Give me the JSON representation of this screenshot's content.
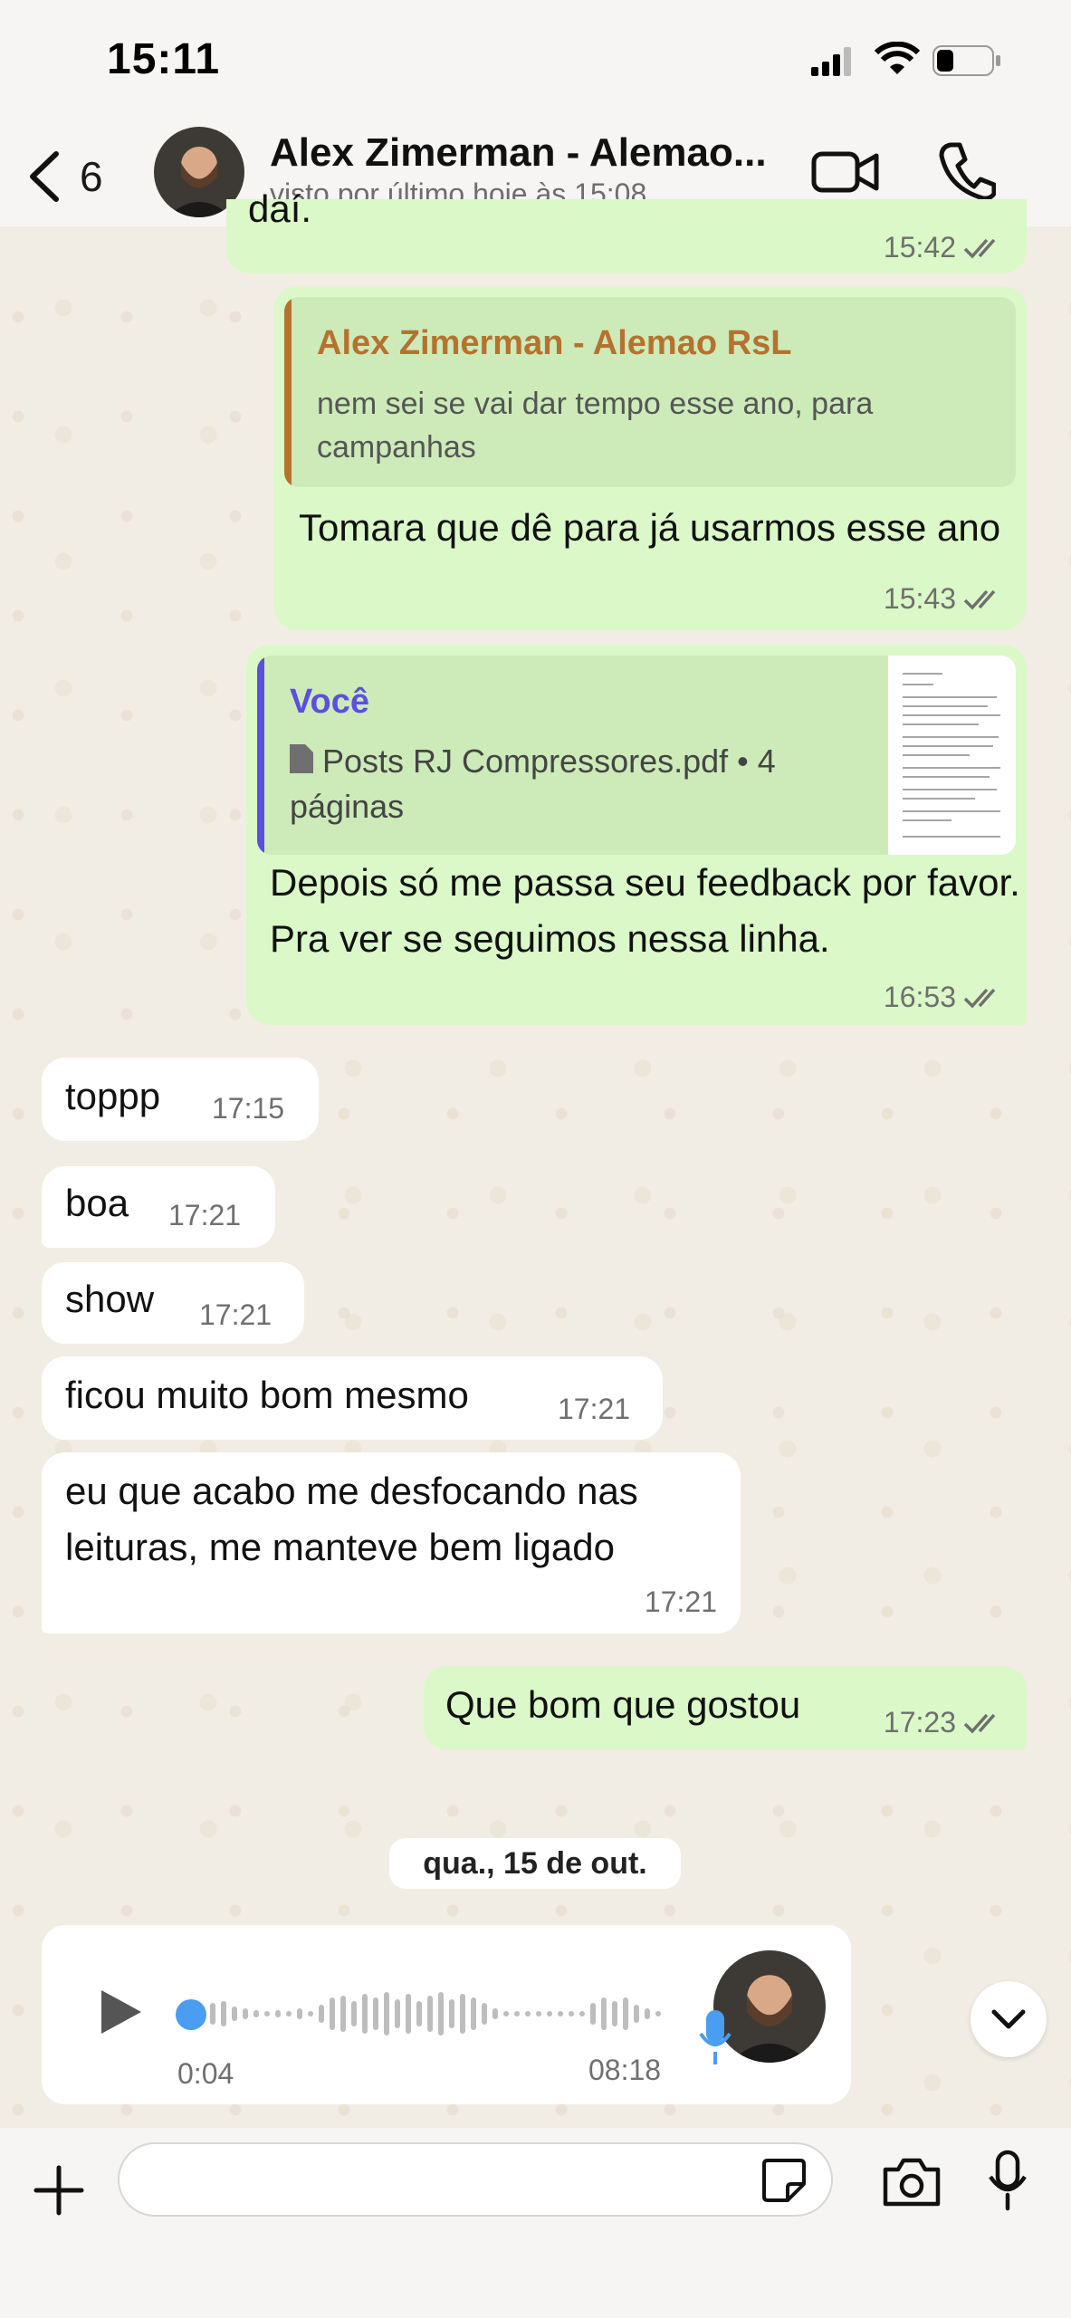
{
  "status_bar": {
    "time": "15:11"
  },
  "header": {
    "back_count": "6",
    "contact_name": "Alex Zimerman - Alemao...",
    "contact_status": "visto por último hoje às 15:08"
  },
  "messages": [
    {
      "text": "daí.",
      "time": "15:42"
    },
    {
      "quote_author": "Alex Zimerman - Alemao RsL",
      "quote_text": "nem sei se vai dar tempo esse ano, para campanhas",
      "text": "Tomara que dê para já usarmos esse ano",
      "time": "15:43"
    },
    {
      "quote_author": "Você",
      "quote_file": "Posts RJ Compressores.pdf • 4 páginas",
      "text": "Depois só me passa seu feedback por favor. Pra ver se seguimos nessa linha.",
      "time": "16:53"
    },
    {
      "text": "toppp",
      "time": "17:15"
    },
    {
      "text": "boa",
      "time": "17:21"
    },
    {
      "text": "show",
      "time": "17:21"
    },
    {
      "text": "ficou muito bom mesmo",
      "time": "17:21"
    },
    {
      "text": "eu que acabo me desfocando nas leituras, me manteve bem ligado",
      "time": "17:21"
    },
    {
      "text": "Que bom que gostou",
      "time": "17:23"
    }
  ],
  "date_separator": "qua., 15 de out.",
  "voice_note": {
    "elapsed": "0:04",
    "duration": "08:18",
    "progress": 0.01
  },
  "colors": {
    "outgoing": "#dbf8c8",
    "incoming": "#ffffff",
    "quote_author_in": "#b5722f",
    "quote_author_me": "#5b4fe0",
    "ticks": "#6f6f6f"
  }
}
